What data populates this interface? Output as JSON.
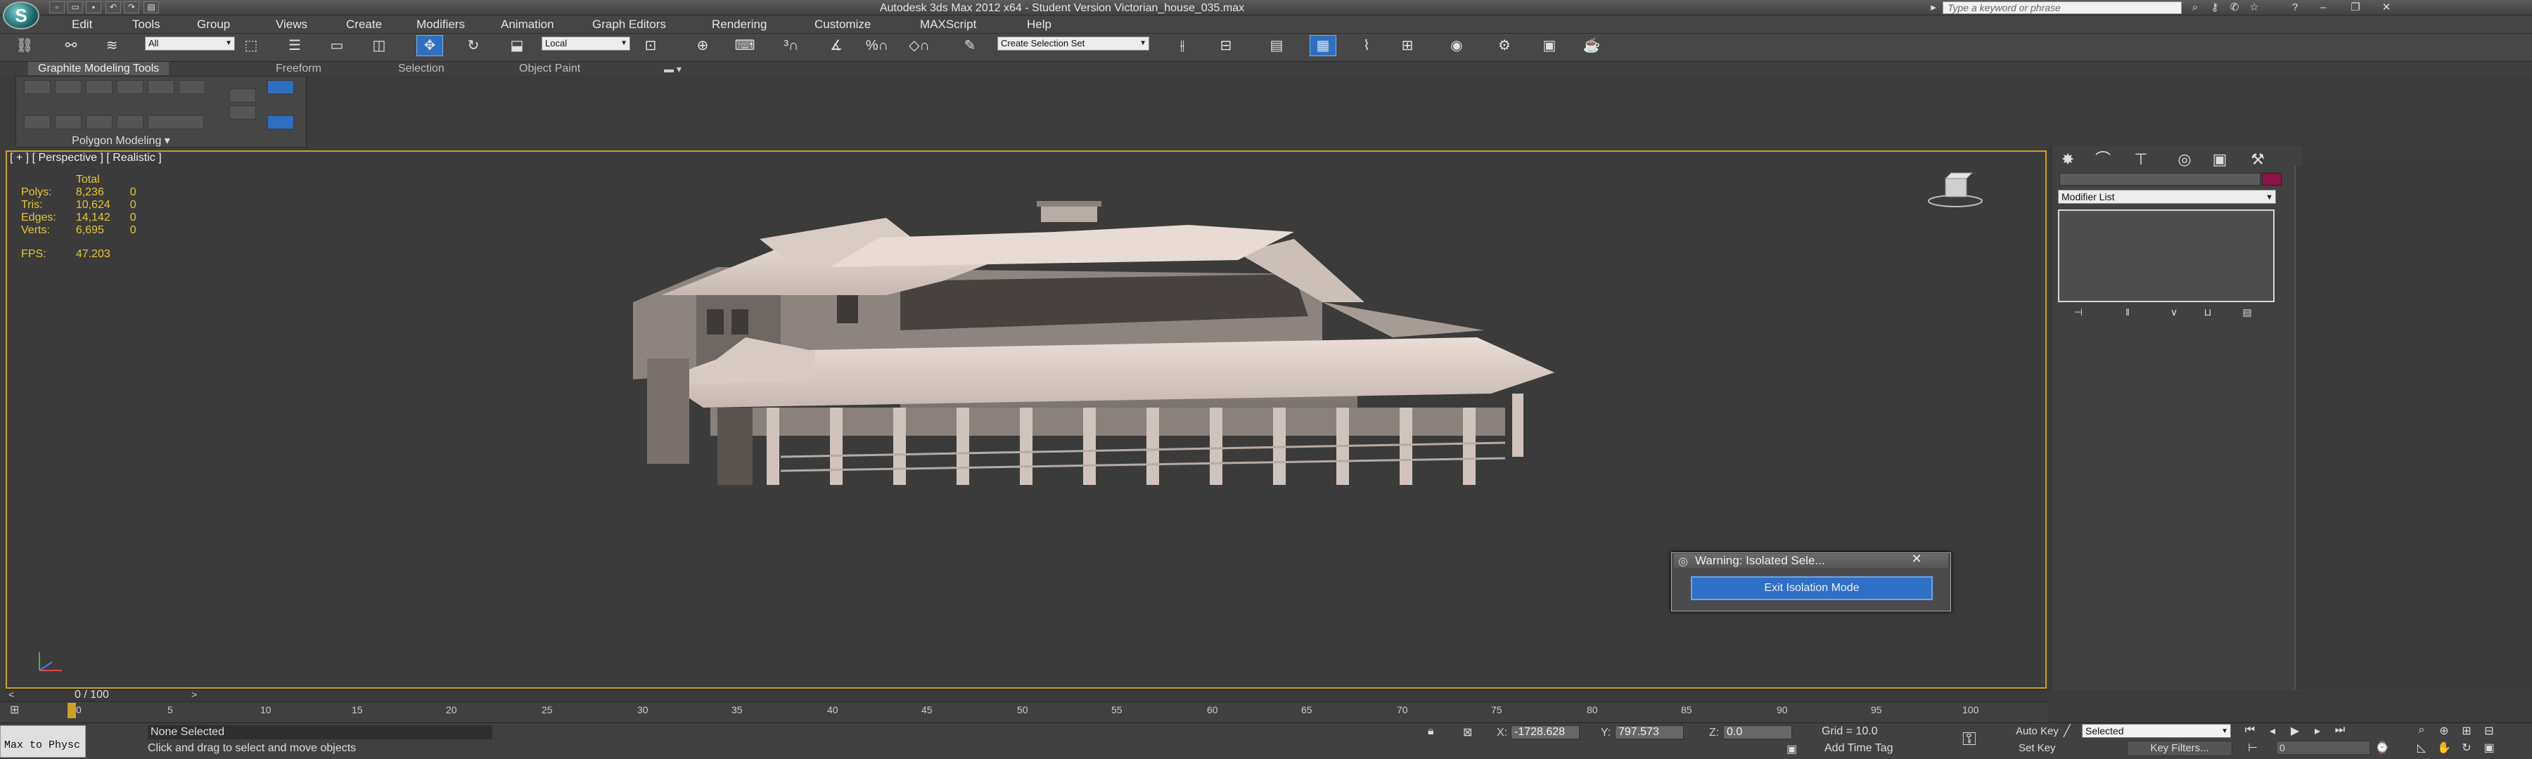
{
  "titlebar": {
    "title": "Autodesk 3ds Max  2012 x64  - Student Version    Victorian_house_035.max",
    "search_placeholder": "Type a keyword or phrase",
    "app_logo_letter": "S"
  },
  "menubar": {
    "items": [
      "Edit",
      "Tools",
      "Group",
      "Views",
      "Create",
      "Modifiers",
      "Animation",
      "Graph Editors",
      "Rendering",
      "Customize",
      "MAXScript",
      "Help"
    ]
  },
  "toolbar": {
    "selection_filter": "All",
    "ref_coord": "Local",
    "named_selection": "Create Selection Set"
  },
  "ribbon": {
    "tabs": [
      "Graphite Modeling Tools",
      "Freeform",
      "Selection",
      "Object Paint"
    ],
    "panel_label": "Polygon Modeling ▾"
  },
  "viewport": {
    "label": "[ + ] [ Perspective ] [ Realistic ]",
    "stats": {
      "header": "Total",
      "rows": [
        {
          "name": "Polys:",
          "total": "8,236",
          "sel": "0"
        },
        {
          "name": "Tris:",
          "total": "10,624",
          "sel": "0"
        },
        {
          "name": "Edges:",
          "total": "14,142",
          "sel": "0"
        },
        {
          "name": "Verts:",
          "total": "6,695",
          "sel": "0"
        }
      ],
      "fps_label": "FPS:",
      "fps_value": "47.203"
    }
  },
  "warning_dialog": {
    "title": "Warning: Isolated Sele...",
    "button": "Exit Isolation Mode"
  },
  "command_panel": {
    "modifier_list": "Modifier List",
    "color_swatch": "#8e1346"
  },
  "timeline": {
    "time_label": "0 / 100",
    "ticks": [
      "0",
      "5",
      "10",
      "15",
      "20",
      "25",
      "30",
      "35",
      "40",
      "45",
      "50",
      "55",
      "60",
      "65",
      "70",
      "75",
      "80",
      "85",
      "90",
      "95",
      "100"
    ]
  },
  "statusbar": {
    "maxscript": "Max to Physc",
    "selection_status": "None Selected",
    "prompt": "Click and drag to select and move objects",
    "x_label": "X:",
    "x_value": "-1728.628",
    "y_label": "Y:",
    "y_value": "797.573",
    "z_label": "Z:",
    "z_value": "0.0",
    "grid": "Grid = 10.0",
    "add_time_tag": "Add Time Tag",
    "auto_key": "Auto Key",
    "set_key": "Set Key",
    "key_mode": "Selected",
    "key_filters": "Key Filters...",
    "frame": "0"
  }
}
